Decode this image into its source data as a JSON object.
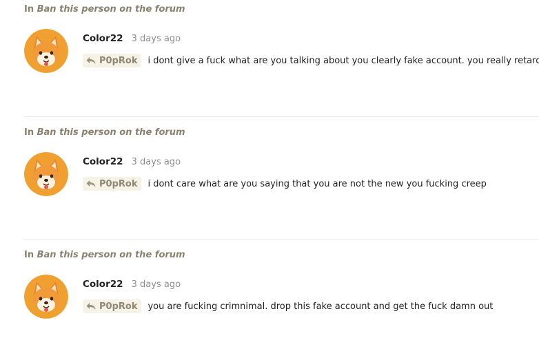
{
  "posts": [
    {
      "context_prefix": "In",
      "context_topic": "Ban this person on the forum",
      "username": "Color22",
      "time": "3 days ago",
      "reply_to": "P0pRok",
      "message": "i dont give a fuck what are you talking about you clearly fake account. you really retard"
    },
    {
      "context_prefix": "In",
      "context_topic": "Ban this person on the forum",
      "username": "Color22",
      "time": "3 days ago",
      "reply_to": "P0pRok",
      "message": "i dont care what are you saying that you are not the new you fucking creep"
    },
    {
      "context_prefix": "In",
      "context_topic": "Ban this person on the forum",
      "username": "Color22",
      "time": "3 days ago",
      "reply_to": "P0pRok",
      "message": "you are fucking crimnimal. drop this fake account and get the fuck damn out"
    }
  ],
  "icons": {
    "avatar": "shiba-dog-avatar-icon",
    "reply": "reply-arrow-icon"
  },
  "colors": {
    "context_text": "#8a8170",
    "reply_chip_bg": "#f6f2e6",
    "avatar_bg": "#f0a030",
    "divider": "#ececec"
  }
}
